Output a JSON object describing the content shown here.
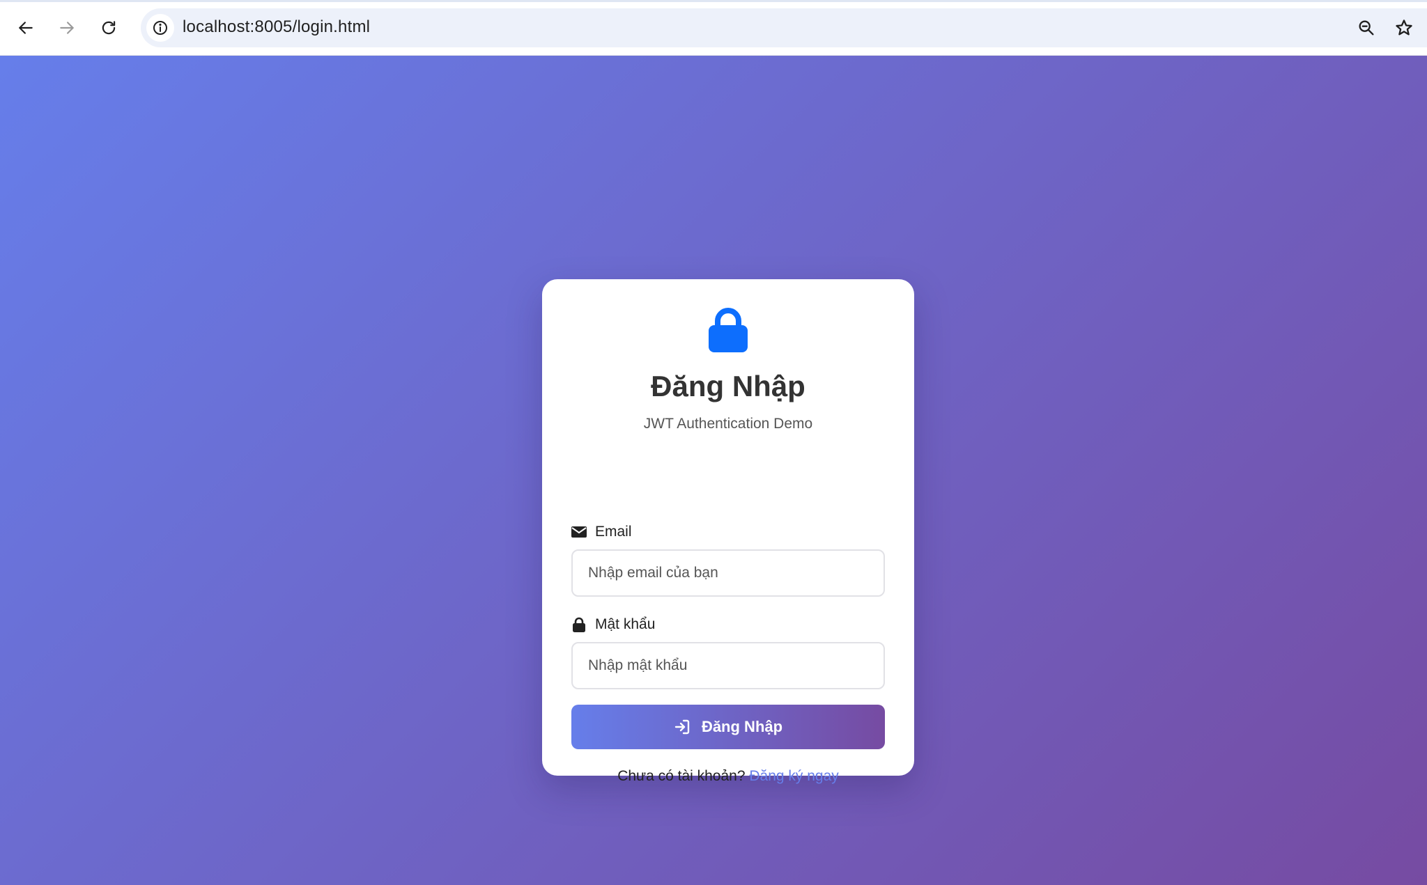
{
  "browser": {
    "url": "localhost:8005/login.html",
    "back_icon": "arrow-left-icon",
    "forward_icon": "arrow-right-icon",
    "reload_icon": "reload-icon",
    "site_info_icon": "info-icon",
    "zoom_icon": "magnifier-zoom-icon",
    "bookmark_icon": "star-icon"
  },
  "page": {
    "background_colors": [
      "#667eea",
      "#764ba2"
    ]
  },
  "login": {
    "header_icon": "lock-icon",
    "title": "Đăng Nhập",
    "subtitle": "JWT Authentication Demo",
    "email": {
      "icon": "envelope-icon",
      "label": "Email",
      "placeholder": "Nhập email của bạn",
      "value": ""
    },
    "password": {
      "icon": "lock-icon",
      "label": "Mật khẩu",
      "placeholder": "Nhập mật khẩu",
      "value": ""
    },
    "submit": {
      "icon": "sign-in-icon",
      "label": "Đăng Nhập"
    },
    "register_prompt": "Chưa có tài khoản?",
    "register_link": "Đăng ký ngay",
    "accent_color": "#0d6efd",
    "link_color": "#667eea"
  }
}
